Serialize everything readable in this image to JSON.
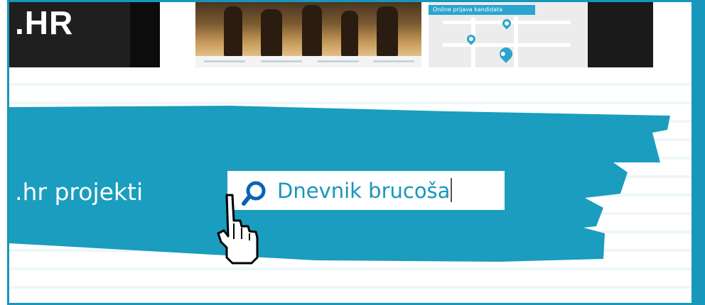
{
  "top_strip": {
    "logo_text": ".HR",
    "map_header": "Online prijava kandidata"
  },
  "banner": {
    "projects_label": ".hr projekti"
  },
  "search": {
    "value": "Dnevnik brucoša"
  },
  "colors": {
    "accent": "#1797bb",
    "banner": "#1a9dbe",
    "search_text": "#1797bb"
  },
  "icons": [
    "search-icon",
    "hand-pointer-cursor-icon",
    "map-pin-icon"
  ]
}
